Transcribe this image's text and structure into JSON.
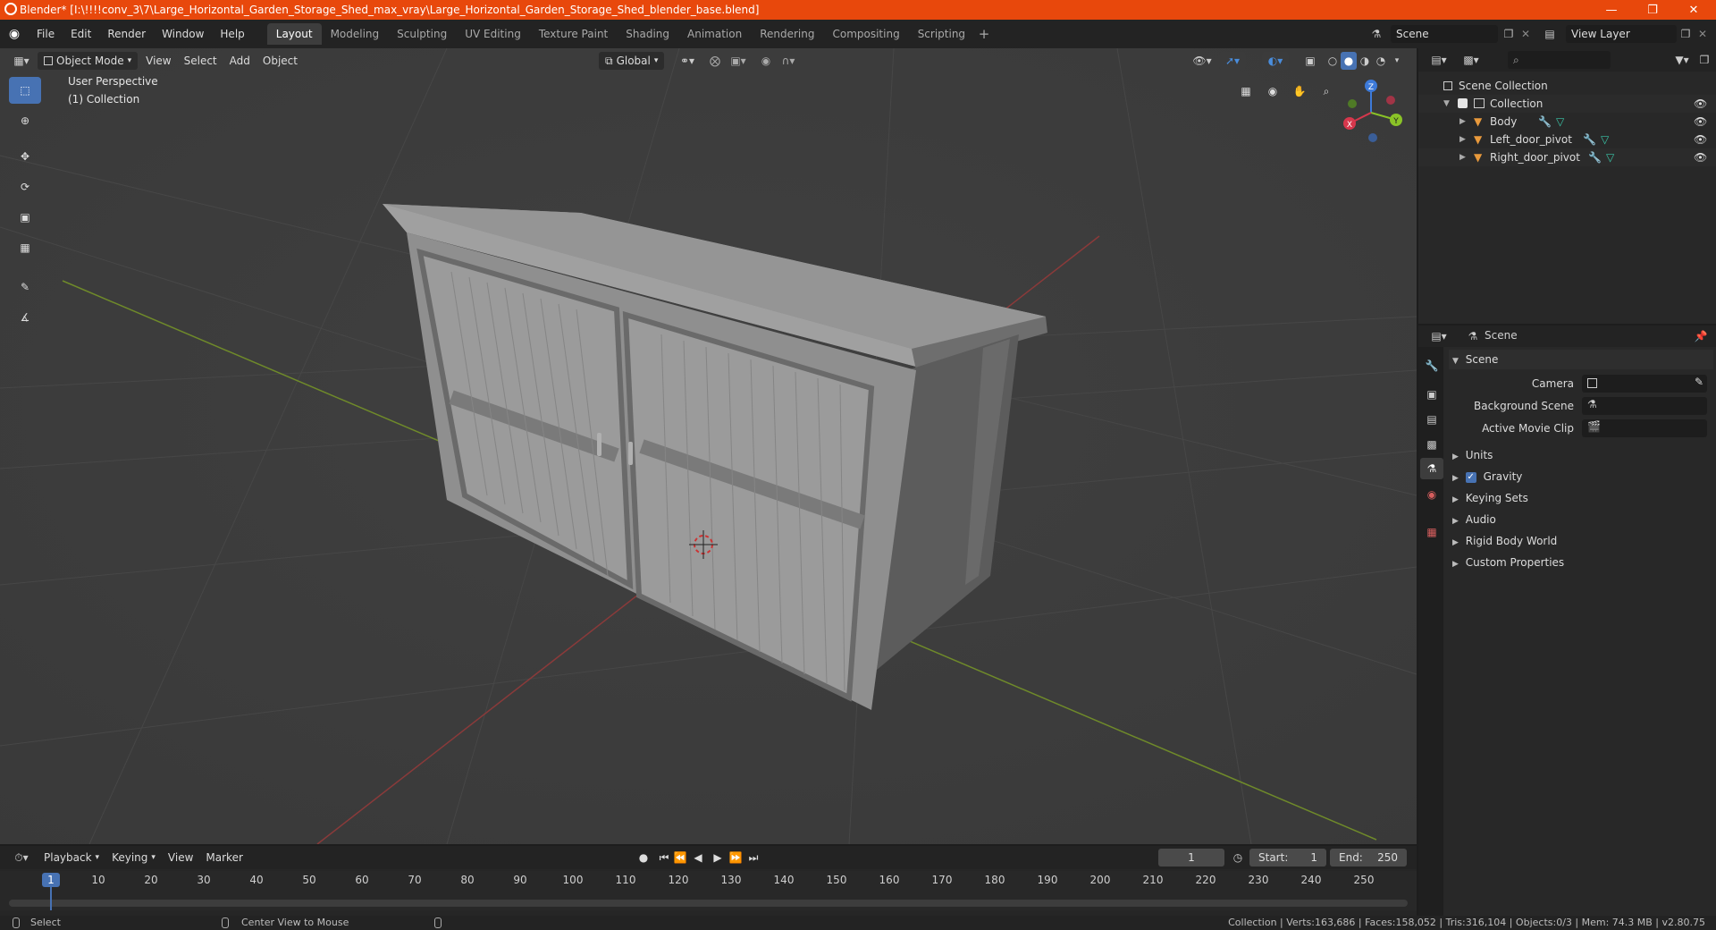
{
  "window": {
    "title": "Blender* [I:\\!!!!conv_3\\7\\Large_Horizontal_Garden_Storage_Shed_max_vray\\Large_Horizontal_Garden_Storage_Shed_blender_base.blend]",
    "accent": "#e8480c"
  },
  "menu": {
    "items": [
      "File",
      "Edit",
      "Render",
      "Window",
      "Help"
    ]
  },
  "workspaces": [
    "Layout",
    "Modeling",
    "Sculpting",
    "UV Editing",
    "Texture Paint",
    "Shading",
    "Animation",
    "Rendering",
    "Compositing",
    "Scripting"
  ],
  "active_workspace": "Layout",
  "scene_selector": "Scene",
  "view_layer": "View Layer",
  "viewport": {
    "mode": "Object Mode",
    "menus": [
      "View",
      "Select",
      "Add",
      "Object"
    ],
    "orientation": "Global",
    "overlay_line1": "User Perspective",
    "overlay_line2": "(1) Collection",
    "gizmo": {
      "x": "X",
      "y": "Y",
      "z": "Z"
    }
  },
  "outliner": {
    "root": "Scene Collection",
    "collection": "Collection",
    "objects": [
      "Body",
      "Left_door_pivot",
      "Right_door_pivot"
    ]
  },
  "properties": {
    "header": "Scene",
    "section": "Scene",
    "camera_label": "Camera",
    "background_scene_label": "Background Scene",
    "active_movie_clip_label": "Active Movie Clip",
    "panels": [
      "Units",
      "Gravity",
      "Keying Sets",
      "Audio",
      "Rigid Body World",
      "Custom Properties"
    ],
    "gravity_enabled": true
  },
  "timeline": {
    "menus": [
      "Playback",
      "Keying",
      "View",
      "Marker"
    ],
    "current_frame": "1",
    "start_label": "Start:",
    "start": "1",
    "end_label": "End:",
    "end": "250",
    "ticks": [
      "1",
      "10",
      "20",
      "30",
      "40",
      "50",
      "60",
      "70",
      "80",
      "90",
      "100",
      "110",
      "120",
      "130",
      "140",
      "150",
      "160",
      "170",
      "180",
      "190",
      "200",
      "210",
      "220",
      "230",
      "240",
      "250"
    ]
  },
  "statusbar": {
    "select": "Select",
    "center_view": "Center View to Mouse",
    "stats": "Collection | Verts:163,686 | Faces:158,052 | Tris:316,104 | Objects:0/3 | Mem: 74.3 MB | v2.80.75"
  }
}
